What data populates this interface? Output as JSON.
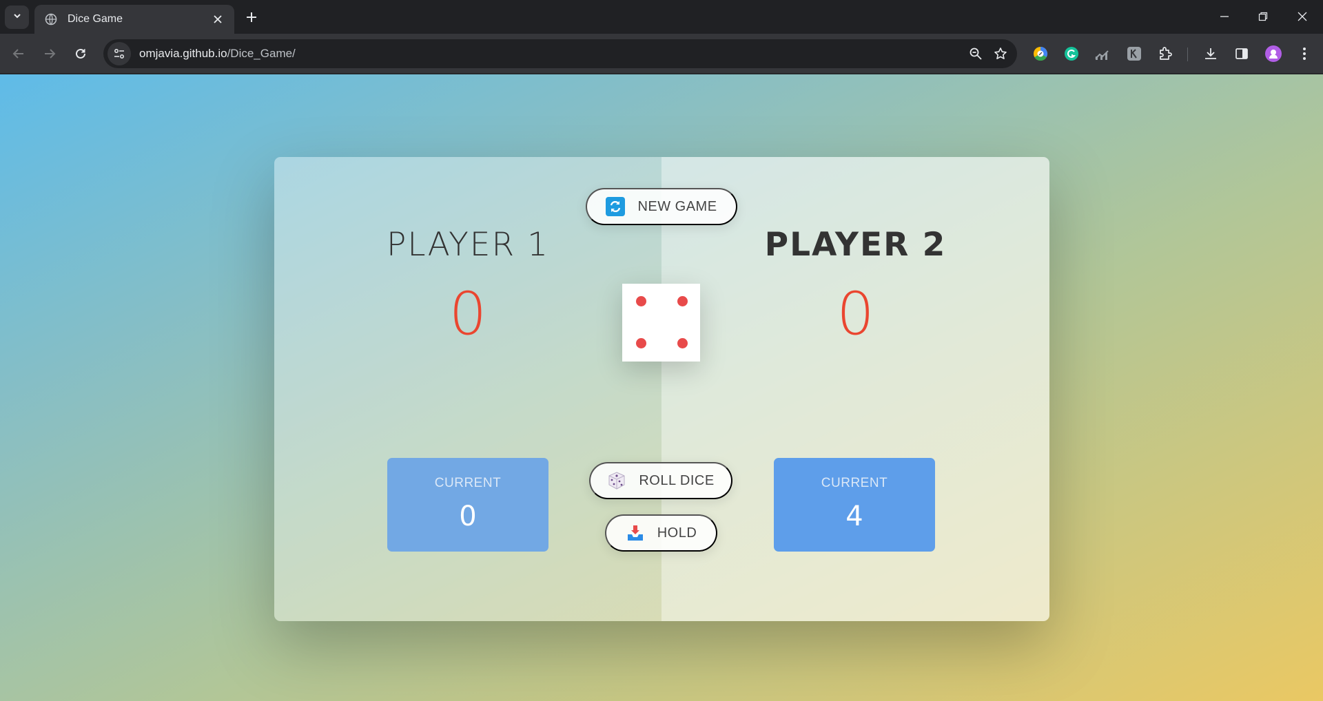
{
  "browser": {
    "tab_title": "Dice Game",
    "url_host": "omjavia.github.io",
    "url_path": "/Dice_Game/"
  },
  "game": {
    "new_game_label": "NEW GAME",
    "roll_dice_label": "ROLL DICE",
    "hold_label": "HOLD",
    "dice_value": 4,
    "players": [
      {
        "name": "PLAYER 1",
        "score": "0",
        "current_label": "CURRENT",
        "current_score": "0",
        "active": false
      },
      {
        "name": "PLAYER 2",
        "score": "0",
        "current_label": "CURRENT",
        "current_score": "4",
        "active": true
      }
    ]
  },
  "colors": {
    "score_red": "#ea4630",
    "current_box": "#5e9eea",
    "pip_red": "#e84a4a"
  }
}
